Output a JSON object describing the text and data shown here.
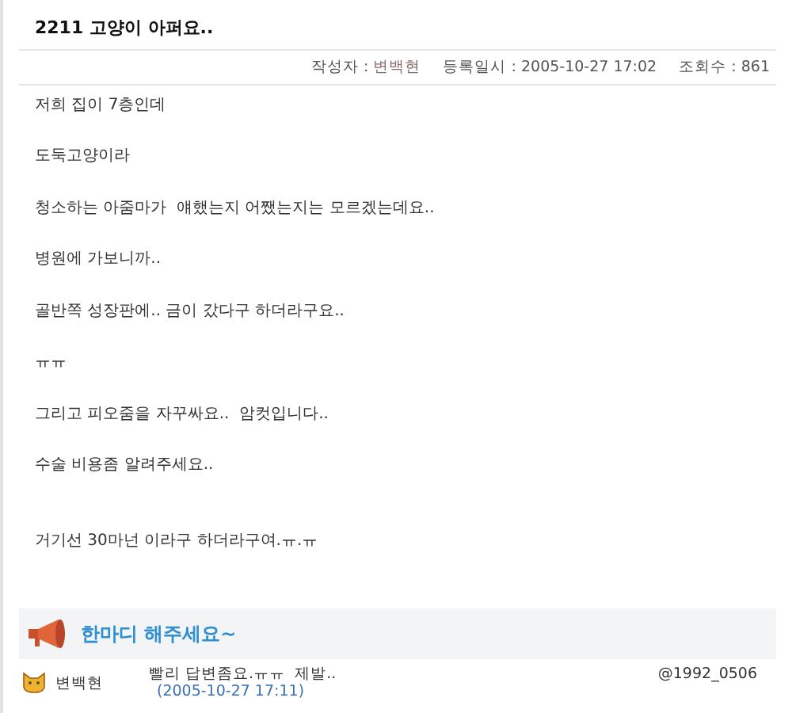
{
  "post": {
    "title": "2211 고양이 아퍼요..",
    "meta": [
      {
        "label": "작성자 :",
        "value": "변백현",
        "kind": "author"
      },
      {
        "label": "등록일시 :",
        "value": "2005-10-27 17:02",
        "kind": "plain"
      },
      {
        "label": "조회수 :",
        "value": "861",
        "kind": "plain"
      }
    ],
    "body": [
      {
        "text": "저희 집이 7층인데",
        "extra_space_before": false
      },
      {
        "text": "도둑고양이라",
        "extra_space_before": false
      },
      {
        "text": "청소하는 아줌마가  얘했는지 어쨌는지는 모르겠는데요..",
        "extra_space_before": false
      },
      {
        "text": "병원에 가보니까..",
        "extra_space_before": false
      },
      {
        "text": "골반쪽 성장판에.. 금이 갔다구 하더라구요..",
        "extra_space_before": false
      },
      {
        "text": "ㅠㅠ",
        "extra_space_before": false
      },
      {
        "text": "그리고 피오줌을 자꾸싸요..  암컷입니다..",
        "extra_space_before": false
      },
      {
        "text": "수술 비용좀 알려주세요..",
        "extra_space_before": false
      },
      {
        "text": "거기선 30마넌 이라구 하더라구여.ㅠ.ㅠ",
        "extra_space_before": true
      }
    ]
  },
  "comments_header": {
    "title": "한마디 해주세요~"
  },
  "comments": [
    {
      "author": "변백현",
      "text": "빨리 답변좀요.ㅠㅠ  제발..",
      "date": "(2005-10-27 17:11)",
      "id": "@1992_0506"
    }
  ]
}
